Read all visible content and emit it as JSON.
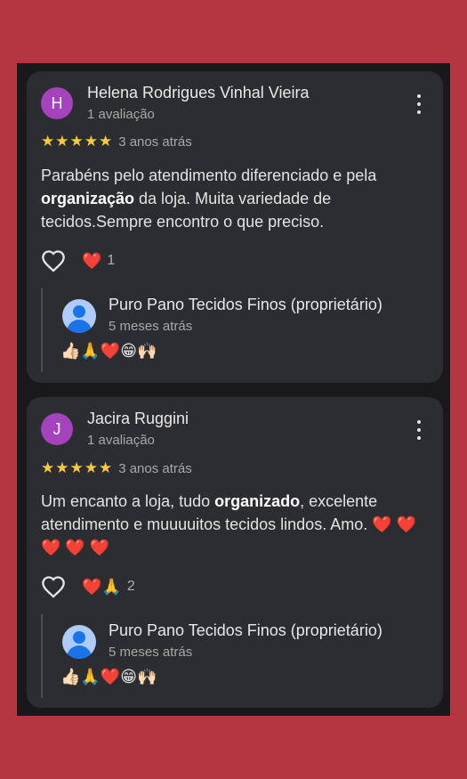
{
  "reviews": [
    {
      "avatar_letter": "H",
      "avatar_color": "#a542bd",
      "name": "Helena Rodrigues Vinhal Vieira",
      "reviews_count": "1 avaliação",
      "stars": "★★★★★",
      "rating": 5,
      "time_ago": "3 anos atrás",
      "text_parts": [
        "Parabéns pelo atendimento diferenciado e pela ",
        "organização",
        " da loja. Muita variedade de tecidos.Sempre encontro o que preciso."
      ],
      "reaction_emoji": "❤️",
      "reaction_count": "1",
      "owner_reply": {
        "name": "Puro Pano Tecidos Finos (proprietário)",
        "time_ago": "5 meses atrás",
        "text": "👍🏻🙏❤️😁🙌🏻"
      }
    },
    {
      "avatar_letter": "J",
      "avatar_color": "#a542bd",
      "name": "Jacira Ruggini",
      "reviews_count": "1 avaliação",
      "stars": "★★★★★",
      "rating": 5,
      "time_ago": "3 anos atrás",
      "text_parts": [
        "Um encanto a loja, tudo ",
        "organizado",
        ", excelente atendimento e muuuuitos tecidos lindos. Amo. ❤️ ❤️ ❤️ ❤️ ❤️"
      ],
      "reaction_emoji": "❤️🙏",
      "reaction_count": "2",
      "owner_reply": {
        "name": "Puro Pano Tecidos Finos (proprietário)",
        "time_ago": "5 meses atrás",
        "text": "👍🏻🙏❤️😁🙌🏻"
      }
    }
  ],
  "colors": {
    "page_background": "#b33640",
    "panel_background": "#19191b",
    "card_background": "#2c2d30",
    "star_color": "#f7c842"
  },
  "icons": {
    "like": "heart-outline-icon",
    "menu": "more-vert-icon",
    "owner_avatar": "person-icon"
  }
}
